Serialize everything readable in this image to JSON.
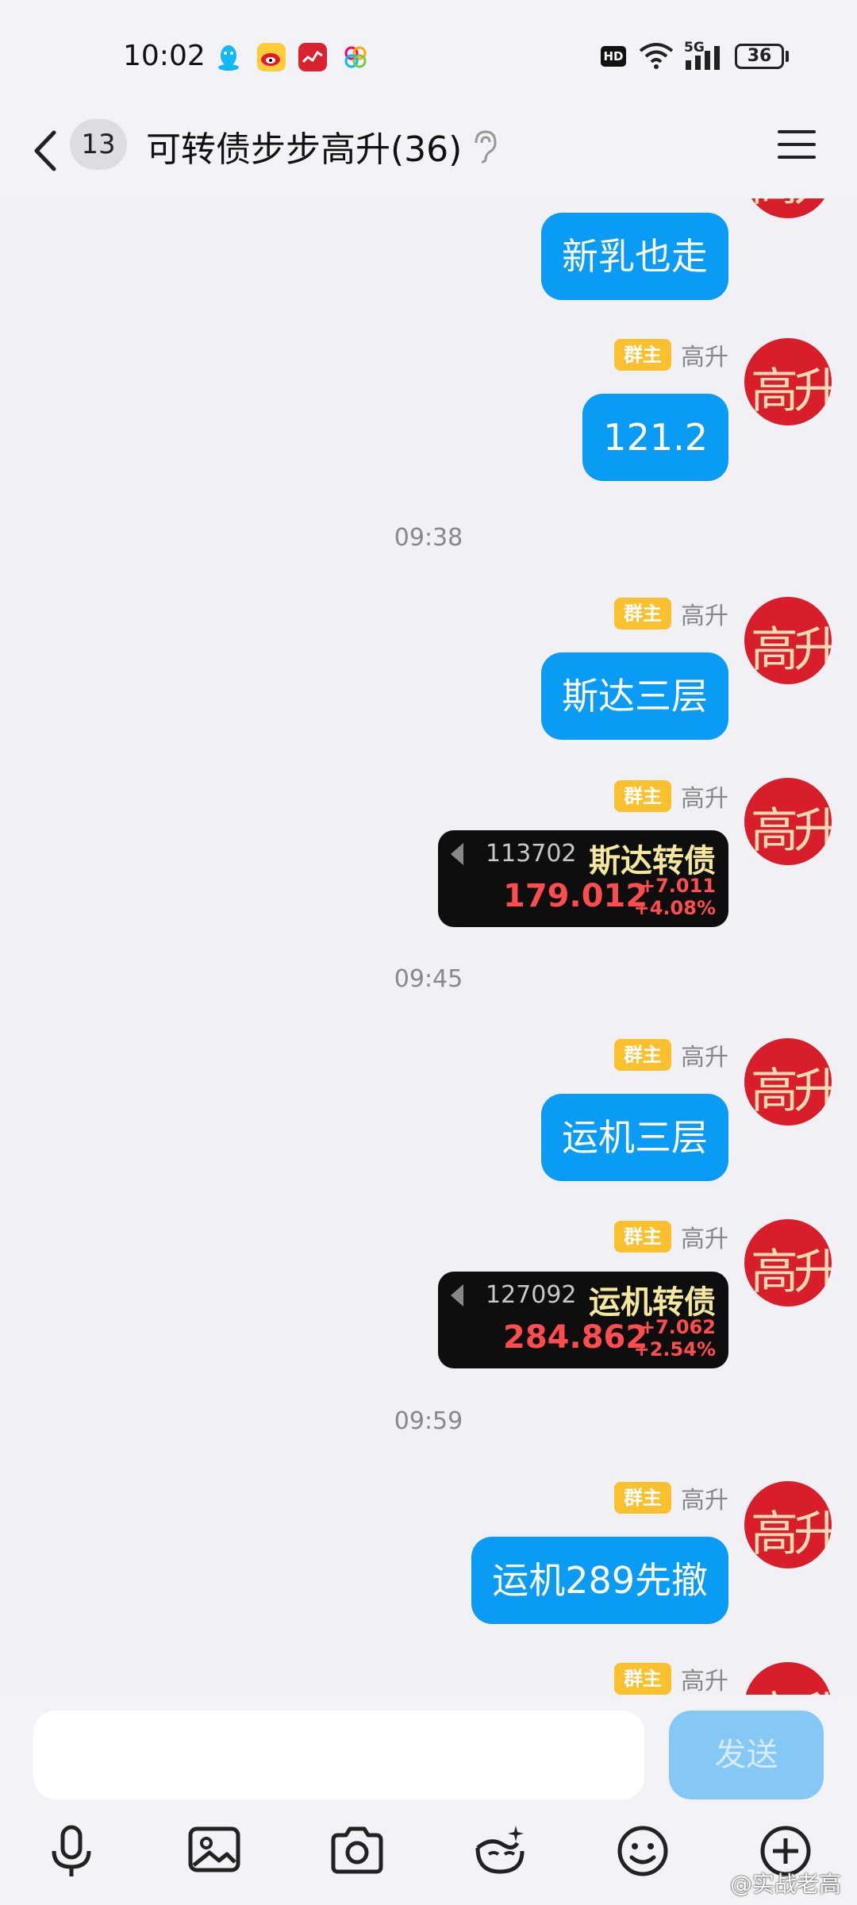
{
  "status_bar": {
    "time": "10:02",
    "hd_label": "HD",
    "network_label": "5G",
    "battery": "36",
    "app_icons": [
      "qq-icon",
      "weibo-icon",
      "stock-app-icon",
      "colorful-app-icon"
    ]
  },
  "header": {
    "unread_count": "13",
    "title": "可转债步步高升(36)"
  },
  "avatar_text": "高升",
  "messages": [
    {
      "type": "text",
      "text": "新乳也走"
    },
    {
      "type": "text",
      "role": "群主",
      "nick": "高升",
      "text": "121.2"
    },
    {
      "type": "time",
      "text": "09:38"
    },
    {
      "type": "text",
      "role": "群主",
      "nick": "高升",
      "text": "斯达三层"
    },
    {
      "type": "quote",
      "role": "群主",
      "nick": "高升",
      "code": "113702",
      "name": "斯达转债",
      "price": "179.012",
      "change": "+7.011",
      "change_pct": "+4.08%"
    },
    {
      "type": "time",
      "text": "09:45"
    },
    {
      "type": "text",
      "role": "群主",
      "nick": "高升",
      "text": "运机三层"
    },
    {
      "type": "quote",
      "role": "群主",
      "nick": "高升",
      "code": "127092",
      "name": "运机转债",
      "price": "284.862",
      "change": "+7.062",
      "change_pct": "+2.54%"
    },
    {
      "type": "time",
      "text": "09:59"
    },
    {
      "type": "text",
      "role": "群主",
      "nick": "高升",
      "text": "运机289先撤"
    },
    {
      "type": "partial",
      "role": "群主",
      "nick": "高升"
    }
  ],
  "input": {
    "value": "",
    "send_label": "发送"
  },
  "toolbar": [
    "microphone-icon",
    "image-icon",
    "camera-icon",
    "face-effect-icon",
    "emoji-icon",
    "plus-icon"
  ],
  "watermark": "@实战老高",
  "colors": {
    "bubble": "#0a9cf5",
    "badge": "#fbc02d",
    "avatar": "#d91e2b",
    "send_disabled": "#86c8f5"
  }
}
